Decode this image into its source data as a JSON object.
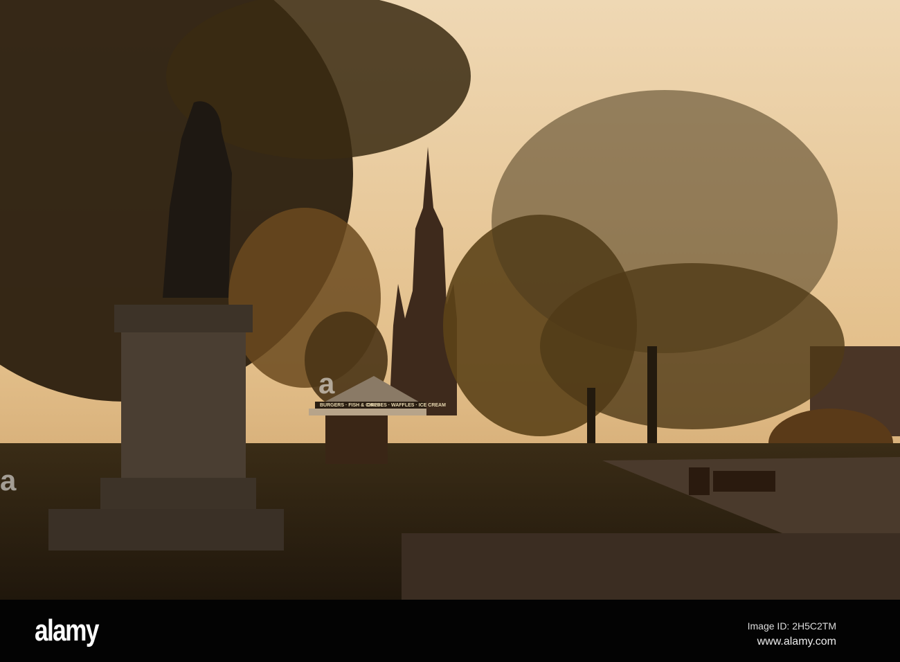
{
  "watermark": {
    "logo": "alamy",
    "image_id": "Image ID: 2H5C2TM",
    "site": "www.alamy.com"
  },
  "scene": {
    "kiosk_sign_left": "BURGERS · FISH & CHIPS",
    "kiosk_sign_right": "CREPES · WAFFLES · ICE CREAM"
  },
  "colors": {
    "sky": "#e9c99a",
    "foliage": "#3a2a12",
    "bar": "#030303"
  }
}
